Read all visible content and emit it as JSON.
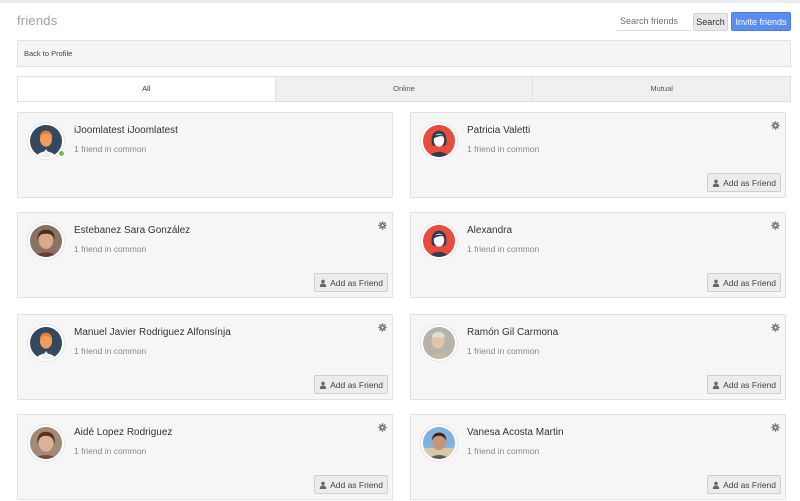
{
  "header": {
    "title": "friends",
    "search_placeholder": "Search friends",
    "search_label": "Search",
    "invite_label": "Invite friends"
  },
  "back_link": "Back to Profile",
  "tabs": [
    {
      "label": "All",
      "active": true
    },
    {
      "label": "Online",
      "active": false
    },
    {
      "label": "Mutual",
      "active": false
    }
  ],
  "friends": [
    {
      "name": "iJoomlatest iJoomlatest",
      "common": "1 friend in common",
      "avatar": "default-male-avatar",
      "online": true,
      "show_add": false,
      "show_gear": false
    },
    {
      "name": "Patricia Valetti",
      "common": "1 friend in common",
      "avatar": "default-female-avatar",
      "online": false,
      "show_add": true,
      "show_gear": true
    },
    {
      "name": "Estebanez Sara González",
      "common": "1 friend in common",
      "avatar": "photo-avatar",
      "online": false,
      "show_add": true,
      "show_gear": true
    },
    {
      "name": "Alexandra",
      "common": "1 friend in common",
      "avatar": "default-female-avatar",
      "online": false,
      "show_add": true,
      "show_gear": true
    },
    {
      "name": "Manuel Javier Rodriguez Alfonsínja",
      "common": "1 friend in common",
      "avatar": "default-male-avatar",
      "online": false,
      "show_add": true,
      "show_gear": true
    },
    {
      "name": "Ramón Gil Carmona",
      "common": "1 friend in common",
      "avatar": "photo-avatar",
      "online": false,
      "show_add": true,
      "show_gear": true
    },
    {
      "name": "Aidé Lopez Rodriguez",
      "common": "1 friend in common",
      "avatar": "photo-avatar",
      "online": false,
      "show_add": true,
      "show_gear": true
    },
    {
      "name": "Vanesa Acosta Martin",
      "common": "1 friend in common",
      "avatar": "photo-avatar",
      "online": false,
      "show_add": true,
      "show_gear": true
    }
  ],
  "add_label": "Add as Friend",
  "colors": {
    "accent": "#5b8df0",
    "online": "#6cc04a",
    "male_avatar_bg": "#34495e",
    "male_avatar_face": "#f39c5a",
    "female_avatar_bg": "#e74c3c",
    "female_avatar_hair": "#2c3e50"
  }
}
